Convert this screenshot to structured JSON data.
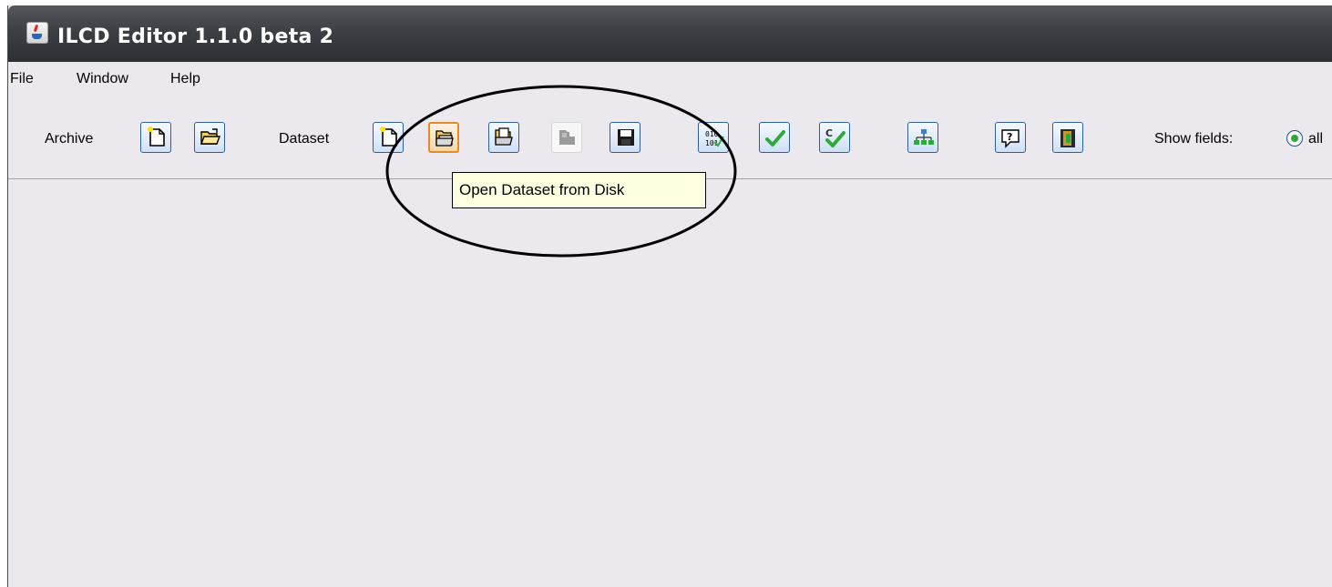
{
  "window": {
    "title": "ILCD Editor 1.1.0 beta 2"
  },
  "menu": {
    "items": [
      "File",
      "Window",
      "Help"
    ]
  },
  "toolbar": {
    "archive_label": "Archive",
    "dataset_label": "Dataset",
    "show_fields_label": "Show fields:",
    "show_fields_option": "all",
    "buttons": [
      {
        "group": "archive",
        "icon": "new-document-icon"
      },
      {
        "group": "archive",
        "icon": "open-folder-icon"
      },
      {
        "group": "dataset",
        "icon": "new-document-icon"
      },
      {
        "group": "dataset",
        "icon": "open-folder-icon",
        "state": "hover"
      },
      {
        "group": "dataset",
        "icon": "folder-open-icon"
      },
      {
        "group": "dataset",
        "icon": "folder-icon",
        "state": "disabled"
      },
      {
        "group": "dataset",
        "icon": "save-icon"
      },
      {
        "group": "tools",
        "icon": "validate-icon"
      },
      {
        "group": "tools",
        "icon": "green-check-icon"
      },
      {
        "group": "tools",
        "icon": "check-compliance-icon"
      },
      {
        "group": "tools",
        "icon": "hierarchy-icon"
      },
      {
        "group": "help",
        "icon": "help-icon"
      },
      {
        "group": "help",
        "icon": "exit-icon"
      }
    ]
  },
  "tooltip": {
    "text": "Open Dataset from Disk"
  },
  "colors": {
    "titlebar": "#3c4045",
    "window_bg": "#ebe9ed",
    "tooltip_bg": "#ffffe1",
    "button_border": "#2f5f9f",
    "hover_border": "#e48a2a",
    "radio_dot": "#2faa3a"
  }
}
